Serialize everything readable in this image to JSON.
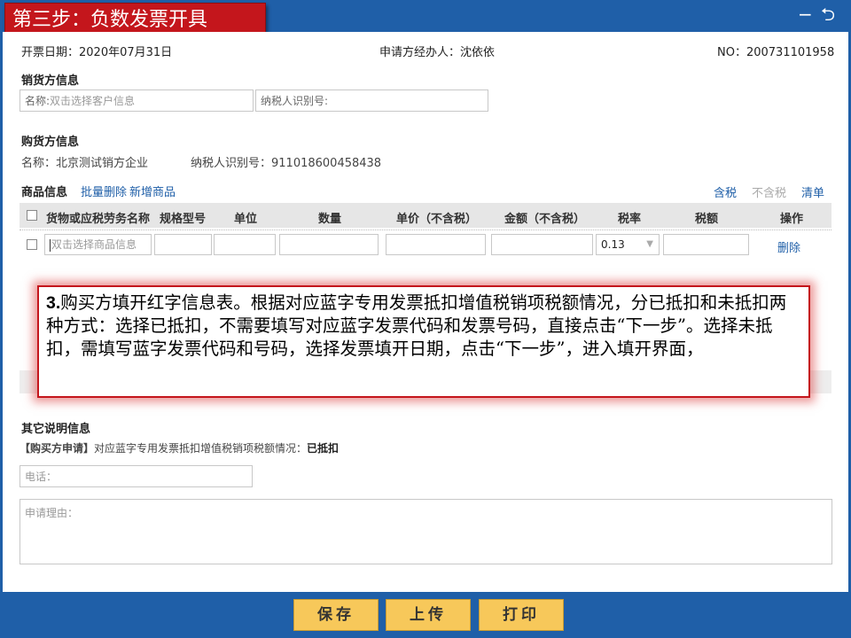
{
  "header": {
    "title": "第三步：负数发票开具",
    "minimize_glyph": "−",
    "back_glyph": "⮌"
  },
  "info": {
    "date": "开票日期：2020年07月31日",
    "handler": "申请方经办人：沈依依",
    "number": "NO：200731101958"
  },
  "seller": {
    "heading": "销货方信息",
    "name_label": "名称:",
    "name_placeholder": "双击选择客户信息",
    "taxid_label": "纳税人识别号:"
  },
  "buyer": {
    "heading": "购货方信息",
    "name": "名称：北京测试销方企业",
    "taxid": "纳税人识别号：911018600458438"
  },
  "goods": {
    "heading": "商品信息",
    "batch_delete": "批量删除",
    "add_item": "新增商品",
    "tax_incl": "含税",
    "tax_excl": "不含税",
    "clear": "清单",
    "columns": [
      "货物或应税劳务名称",
      "规格型号",
      "单位",
      "数量",
      "单价（不含税）",
      "金额（不含税）",
      "税率",
      "税额",
      "操作"
    ],
    "row": {
      "name_placeholder": "双击选择商品信息",
      "tax_rate": "0.13",
      "delete": "删除"
    }
  },
  "tooltip": {
    "number": "3.",
    "text": "购买方填开红字信息表。根据对应蓝字专用发票抵扣增值税销项税额情况，分已抵扣和未抵扣两种方式：选择已抵扣，不需要填写对应蓝字发票代码和发票号码，直接点击“下一步”。选择未抵扣，需填写蓝字发票代码和号码，选择发票填开日期，点击“下一步”，进入填开界面，"
  },
  "other": {
    "heading": "其它说明信息",
    "apply_tag": "【购买方申请】",
    "apply_text": "对应蓝字专用发票抵扣增值税销项税额情况：",
    "apply_value": "已抵扣",
    "phone_label": "电话：",
    "reason_label": "申请理由："
  },
  "buttons": {
    "save": "保存",
    "upload": "上传",
    "print": "打印"
  },
  "colors": {
    "primary": "#1f5fa8",
    "title_red": "#c4161c",
    "button_yellow": "#f7c85a"
  }
}
